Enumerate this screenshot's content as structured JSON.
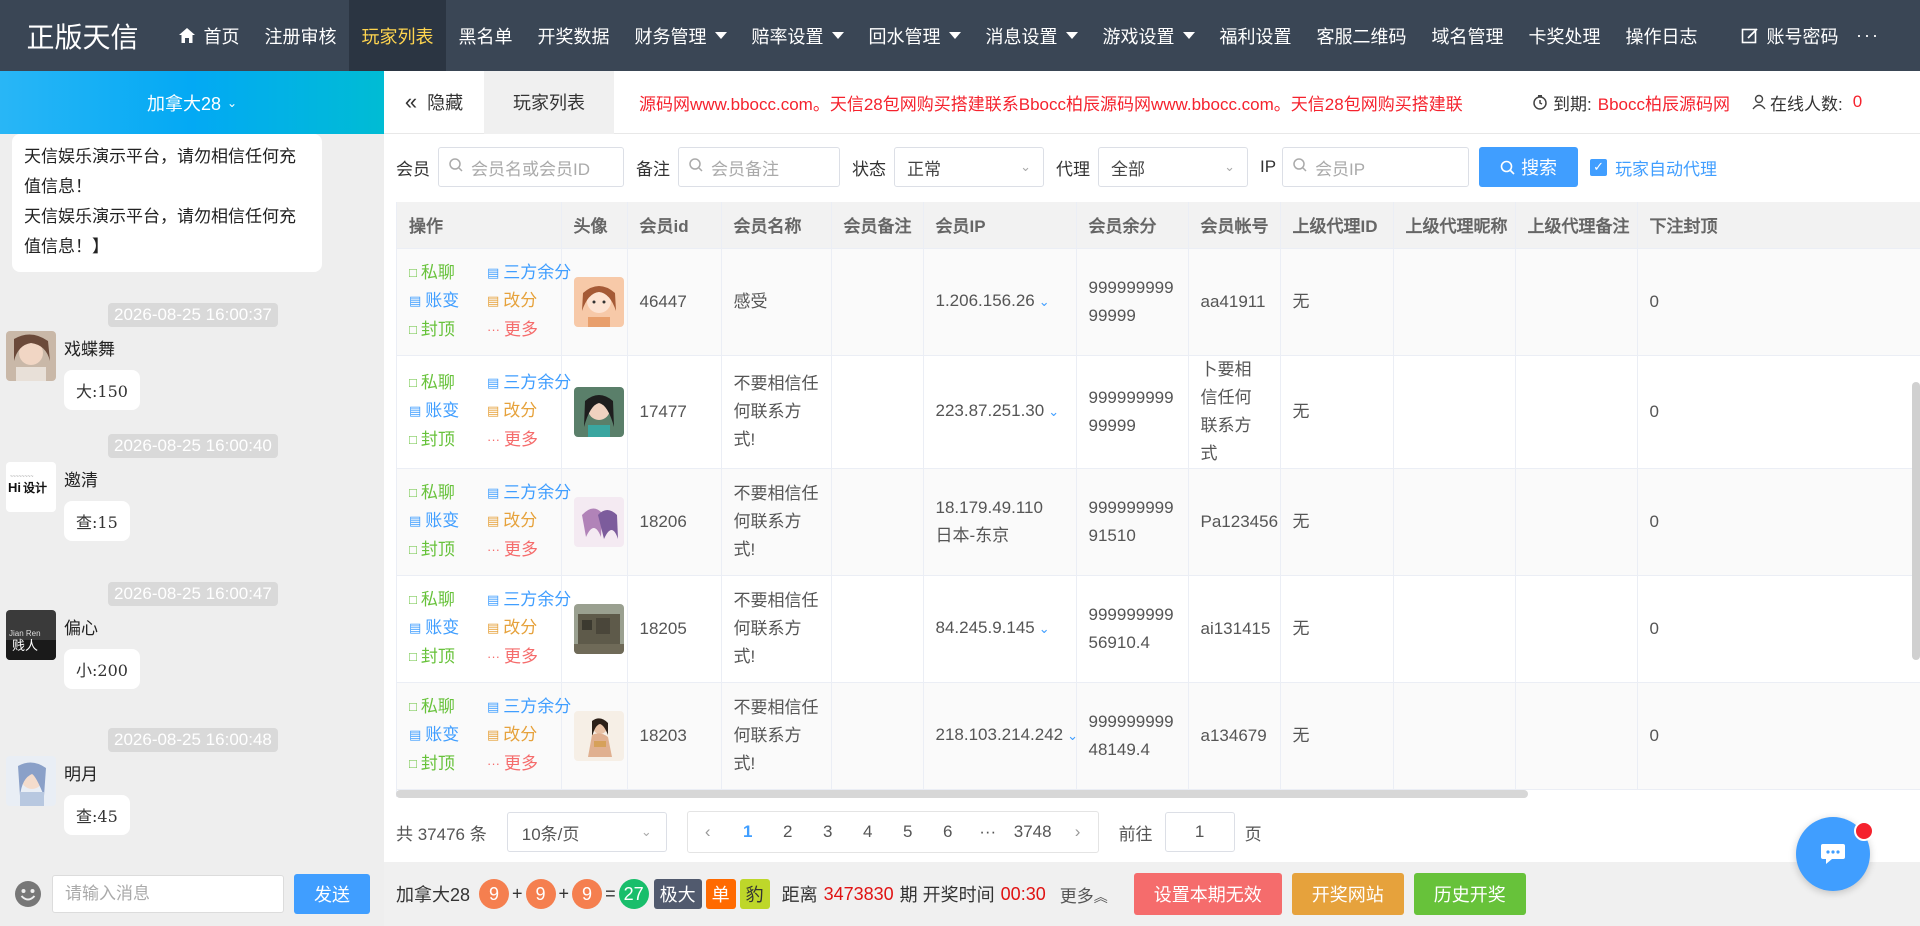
{
  "brand": "正版天信",
  "nav": {
    "items": [
      {
        "label": "首页",
        "icon": "home-icon"
      },
      {
        "label": "注册审核"
      },
      {
        "label": "玩家列表",
        "active": true
      },
      {
        "label": "黑名单"
      },
      {
        "label": "开奖数据"
      },
      {
        "label": "财务管理",
        "dropdown": true
      },
      {
        "label": "赔率设置",
        "dropdown": true
      },
      {
        "label": "回水管理",
        "dropdown": true
      },
      {
        "label": "消息设置",
        "dropdown": true
      },
      {
        "label": "游戏设置",
        "dropdown": true
      },
      {
        "label": "福利设置"
      },
      {
        "label": "客服二维码"
      },
      {
        "label": "域名管理"
      },
      {
        "label": "卡奖处理"
      },
      {
        "label": "操作日志"
      },
      {
        "label": "账号密码",
        "icon": "edit-icon"
      }
    ],
    "more": "···"
  },
  "sidebar": {
    "room": "加拿大28",
    "first_bubble": "天信娱乐演示平台，请勿相信任何充值信息！\n天信娱乐演示平台，请勿相信任何充值信息！】",
    "messages": [
      {
        "time": "2026-08-25 16:00:37",
        "name": "戏蝶舞",
        "text": "大:150"
      },
      {
        "time": "2026-08-25 16:00:40",
        "name": "邀清",
        "text": "查:15"
      },
      {
        "time": "2026-08-25 16:00:47",
        "name": "偏心",
        "text": "小:200"
      },
      {
        "time": "2026-08-25 16:00:48",
        "name": "明月",
        "text": "查:45"
      }
    ],
    "input_placeholder": "请输入消息",
    "send_label": "发送"
  },
  "tabbar": {
    "hide_label": "隐藏",
    "current_tab": "玩家列表",
    "marquee": "源码网www.bbocc.com。天信28包网购买搭建联系Bbocc柏辰源码网www.bbocc.com。天信28包网购买搭建联",
    "expire_label": "到期:",
    "expire_value": "Bbocc柏辰源码网",
    "online_label": "在线人数:",
    "online_value": "0"
  },
  "filters": {
    "member_label": "会员",
    "member_placeholder": "会员名或会员ID",
    "note_label": "备注",
    "note_placeholder": "会员备注",
    "status_label": "状态",
    "status_value": "正常",
    "agent_label": "代理",
    "agent_value": "全部",
    "ip_label": "IP",
    "ip_placeholder": "会员IP",
    "search_label": "搜索",
    "auto_agent_label": "玩家自动代理"
  },
  "table": {
    "columns": [
      "操作",
      "头像",
      "会员id",
      "会员名称",
      "会员备注",
      "会员IP",
      "会员余分",
      "会员帐号",
      "上级代理ID",
      "上级代理昵称",
      "上级代理备注",
      "下注封顶"
    ],
    "ops": {
      "chat": "私聊",
      "third": "三方余分",
      "ledger": "账变",
      "adjust": "改分",
      "ban": "封顶",
      "more": "更多"
    },
    "rows": [
      {
        "id": "46447",
        "name": "感受",
        "note": "",
        "ip": "1.206.156.26",
        "ip2": "",
        "ip_dropdown": true,
        "balance": "99999999999999",
        "account": "aa41911",
        "pid": "无",
        "pnick": "",
        "pnote": "",
        "cap": "0"
      },
      {
        "id": "17477",
        "name": "不要相信任何联系方式!",
        "note": "",
        "ip": "223.87.251.30",
        "ip2": "",
        "ip_dropdown": true,
        "balance": "99999999999999",
        "account": "卜要相信任何联系方式",
        "pid": "无",
        "pnick": "",
        "pnote": "",
        "cap": "0"
      },
      {
        "id": "18206",
        "name": "不要相信任何联系方式!",
        "note": "",
        "ip": "18.179.49.110",
        "ip2": "日本-东京",
        "ip_dropdown": false,
        "balance": "99999999991510",
        "account": "Pa123456",
        "pid": "无",
        "pnick": "",
        "pnote": "",
        "cap": "0"
      },
      {
        "id": "18205",
        "name": "不要相信任何联系方式!",
        "note": "",
        "ip": "84.245.9.145",
        "ip2": "",
        "ip_dropdown": true,
        "balance": "99999999956910.4",
        "account": "ai131415",
        "pid": "无",
        "pnick": "",
        "pnote": "",
        "cap": "0"
      },
      {
        "id": "18203",
        "name": "不要相信任何联系方式!",
        "note": "",
        "ip": "218.103.214.242",
        "ip2": "",
        "ip_dropdown": true,
        "balance": "99999999948149.4",
        "account": "a134679",
        "pid": "无",
        "pnick": "",
        "pnote": "",
        "cap": "0"
      }
    ]
  },
  "pager": {
    "total": "共 37476 条",
    "page_size": "10条/页",
    "pages": [
      "1",
      "2",
      "3",
      "4",
      "5",
      "6",
      "···",
      "3748"
    ],
    "current": "1",
    "goto_label": "前往",
    "goto_value": "1",
    "page_unit": "页"
  },
  "footer": {
    "lottery": "加拿大28",
    "balls": [
      "9",
      "9",
      "9"
    ],
    "sum": "27",
    "tags": [
      "极大",
      "单",
      "豹"
    ],
    "distance_label": "距离",
    "issue": "3473830",
    "issue_suffix": "期 开奖时间",
    "countdown": "00:30",
    "more": "更多",
    "btn_invalid": "设置本期无效",
    "btn_site": "开奖网站",
    "btn_history": "历史开奖"
  },
  "colors": {
    "topnav": "#3a4655",
    "accent": "#409eff",
    "active_nav": "#ffd54f",
    "alert_red": "#f5222d"
  }
}
